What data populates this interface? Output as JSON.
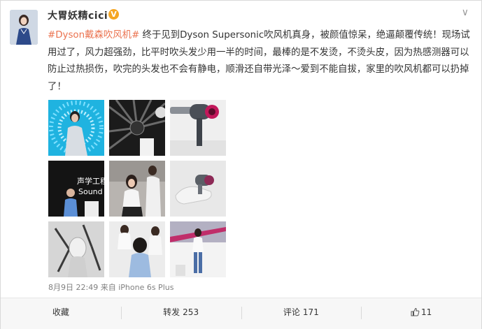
{
  "user": {
    "name": "大胃妖精cici",
    "badge_letter": "V"
  },
  "post": {
    "topic": "#Dyson戴森吹风机#",
    "body": " 终于见到Dyson Supersonic吹风机真身，被颜值惊呆，绝逼颠覆传统！现场试用过了，风力超强劲，比平时吹头发少用一半的时间，最棒的是不发烫，不烫头皮，因为热感测器可以防止过热损伤，吹完的头发也不会有静电，顺滑还自带光泽～爱到不能自拔，家里的吹风机都可以扔掉了！",
    "image_overlay_text": [
      "声学工程",
      "Sound"
    ]
  },
  "meta": {
    "time": "8月9日 22:49",
    "source_prefix": "来自",
    "device": "iPhone 6s Plus"
  },
  "actions": {
    "favorite": "收藏",
    "repost_label": "转发",
    "repost_count": "253",
    "comment_label": "评论",
    "comment_count": "171",
    "like_count": "11"
  },
  "icons": {
    "menu": "chevron-down-icon",
    "like": "thumbs-up-icon"
  },
  "colors": {
    "topic": "#eb7350",
    "verified_badge": "#f5a623",
    "meta_text": "#808080"
  }
}
